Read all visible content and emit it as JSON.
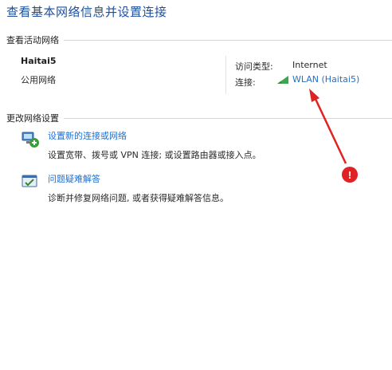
{
  "page": {
    "title": "查看基本网络信息并设置连接"
  },
  "active_networks": {
    "header": "查看活动网络",
    "network_name": "Haitai5",
    "network_category": "公用网络",
    "access_type_label": "访问类型:",
    "access_type_value": "Internet",
    "connections_label": "连接:",
    "connection_link": "WLAN (Haitai5)"
  },
  "change_settings": {
    "header": "更改网络设置",
    "tasks": [
      {
        "label": "设置新的连接或网络",
        "description": "设置宽带、拨号或 VPN 连接; 或设置路由器或接入点。",
        "icon": "network-setup-icon"
      },
      {
        "label": "问题疑难解答",
        "description": "诊断并修复网络问题, 或者获得疑难解答信息。",
        "icon": "troubleshoot-icon"
      }
    ]
  },
  "annotation": {
    "badge_text": "!",
    "color": "#e02222"
  },
  "colors": {
    "link": "#1f6fcf",
    "title": "#1e4f9e",
    "signal": "#3aa84a"
  }
}
